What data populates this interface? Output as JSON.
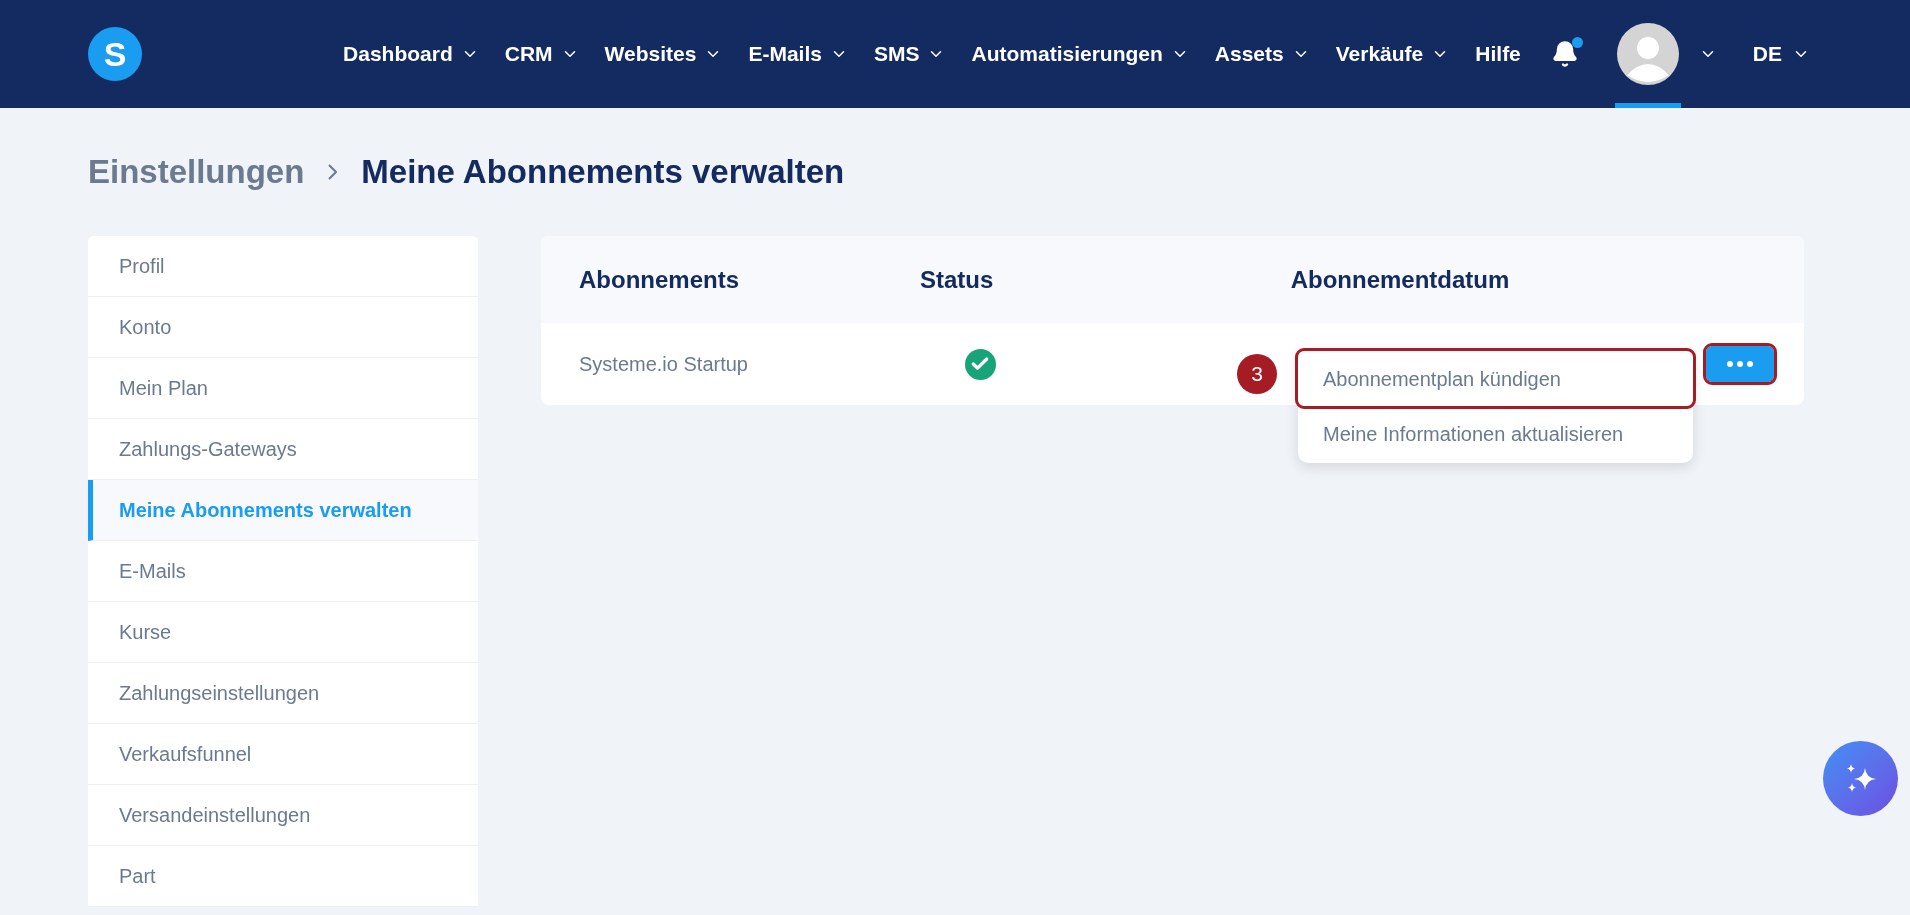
{
  "logo": {
    "letter": "S"
  },
  "nav": [
    {
      "label": "Dashboard",
      "dropdown": true
    },
    {
      "label": "CRM",
      "dropdown": true
    },
    {
      "label": "Websites",
      "dropdown": true
    },
    {
      "label": "E-Mails",
      "dropdown": true
    },
    {
      "label": "SMS",
      "dropdown": true
    },
    {
      "label": "Automatisierungen",
      "dropdown": true
    },
    {
      "label": "Assets",
      "dropdown": true
    },
    {
      "label": "Verkäufe",
      "dropdown": true
    },
    {
      "label": "Hilfe",
      "dropdown": false
    }
  ],
  "notifications": {
    "unread": true
  },
  "account": {
    "selected": true
  },
  "language": "DE",
  "breadcrumb": [
    "Einstellungen",
    "Meine Abonnements verwalten"
  ],
  "sidebar": {
    "items": [
      {
        "label": "Profil",
        "selected": false
      },
      {
        "label": "Konto",
        "selected": false
      },
      {
        "label": "Mein Plan",
        "selected": false
      },
      {
        "label": "Zahlungs-Gateways",
        "selected": false
      },
      {
        "label": "Meine Abonnements verwalten",
        "selected": true
      },
      {
        "label": "E-Mails",
        "selected": false
      },
      {
        "label": "Kurse",
        "selected": false
      },
      {
        "label": "Zahlungseinstellungen",
        "selected": false
      },
      {
        "label": "Verkaufsfunnel",
        "selected": false
      },
      {
        "label": "Versandeinstellungen",
        "selected": false
      },
      {
        "label": "Part",
        "selected": false
      }
    ]
  },
  "table": {
    "columns": [
      "Abonnements",
      "Status",
      "Abonnementdatum"
    ],
    "rows": [
      {
        "name": "Systeme.io Startup",
        "active": true
      }
    ]
  },
  "menu": {
    "items": [
      {
        "label": "Abonnementplan kündigen",
        "highlighted": true
      },
      {
        "label": "Meine Informationen aktualisieren",
        "highlighted": false
      }
    ]
  },
  "step_badge": "3",
  "more_button": {
    "highlighted": true
  }
}
